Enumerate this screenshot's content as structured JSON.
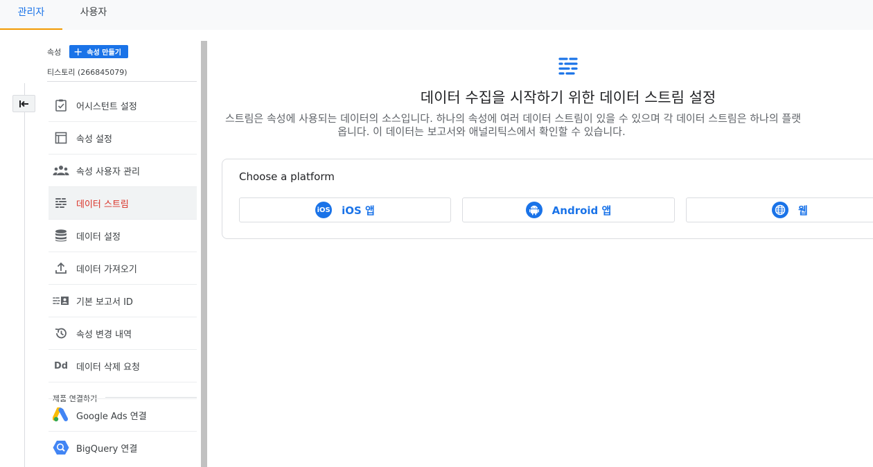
{
  "tabs": [
    {
      "label": "관리자",
      "active": true
    },
    {
      "label": "사용자",
      "active": false
    }
  ],
  "sidebar": {
    "property_label": "속성",
    "create_button": "속성 만들기",
    "property_name": "티스토리 (266845079)",
    "items": [
      {
        "label": "어시스턴트 설정",
        "icon": "checklist-icon"
      },
      {
        "label": "속성 설정",
        "icon": "layout-icon"
      },
      {
        "label": "속성 사용자 관리",
        "icon": "people-icon"
      },
      {
        "label": "데이터 스트림",
        "icon": "data-stream-icon",
        "active": true
      },
      {
        "label": "데이터 설정",
        "icon": "database-icon"
      },
      {
        "label": "데이터 가져오기",
        "icon": "upload-icon"
      },
      {
        "label": "기본 보고서 ID",
        "icon": "id-card-icon"
      },
      {
        "label": "속성 변경 내역",
        "icon": "history-icon"
      },
      {
        "label": "데이터 삭제 요청",
        "icon": "dd-icon"
      }
    ],
    "section_title": "제품 연결하기",
    "links": [
      {
        "label": "Google Ads 연결",
        "icon": "google-ads-icon"
      },
      {
        "label": "BigQuery 연결",
        "icon": "bigquery-icon"
      }
    ]
  },
  "main": {
    "title": "데이터 수집을 시작하기 위한 데이터 스트림 설정",
    "description_line1": "스트림은 속성에 사용되는 데이터의 소스입니다. 하나의 속성에 여러 데이터 스트림이 있을 수 있으며 각 데이터 스트림은 하나의 플랫",
    "description_line2": "옵니다. 이 데이터는 보고서와 애널리틱스에서 확인할 수 있습니다.",
    "platform_title": "Choose a platform",
    "platforms": [
      {
        "label": "iOS 앱",
        "icon": "ios-icon"
      },
      {
        "label": "Android 앱",
        "icon": "android-icon"
      },
      {
        "label": "웹",
        "icon": "globe-icon"
      }
    ]
  },
  "colors": {
    "accent": "#1a73e8",
    "active_red": "#d93025",
    "tab_underline": "#f29900"
  }
}
